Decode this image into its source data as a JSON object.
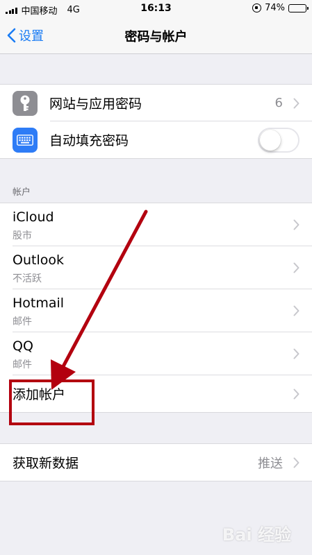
{
  "status_bar": {
    "carrier": "中国移动",
    "network": "4G",
    "time": "16:13",
    "battery": "74%",
    "battery_level": 0.74
  },
  "nav": {
    "back_label": "设置",
    "title": "密码与帐户"
  },
  "passwords": {
    "website_app_passwords": {
      "label": "网站与应用密码",
      "count": "6"
    },
    "autofill": {
      "label": "自动填充密码",
      "enabled": false
    }
  },
  "accounts": {
    "header": "帐户",
    "items": [
      {
        "title": "iCloud",
        "subtitle": "股市"
      },
      {
        "title": "Outlook",
        "subtitle": "不活跃"
      },
      {
        "title": "Hotmail",
        "subtitle": "邮件"
      },
      {
        "title": "QQ",
        "subtitle": "邮件"
      }
    ],
    "add_account": "添加帐户"
  },
  "fetch": {
    "label": "获取新数据",
    "value": "推送"
  },
  "watermark": "Bai 经验",
  "colors": {
    "accent": "#1a7cf4",
    "annotation": "#b3000f",
    "key_icon_bg": "#8e8e93",
    "keyboard_icon_bg": "#2e7cf6"
  }
}
